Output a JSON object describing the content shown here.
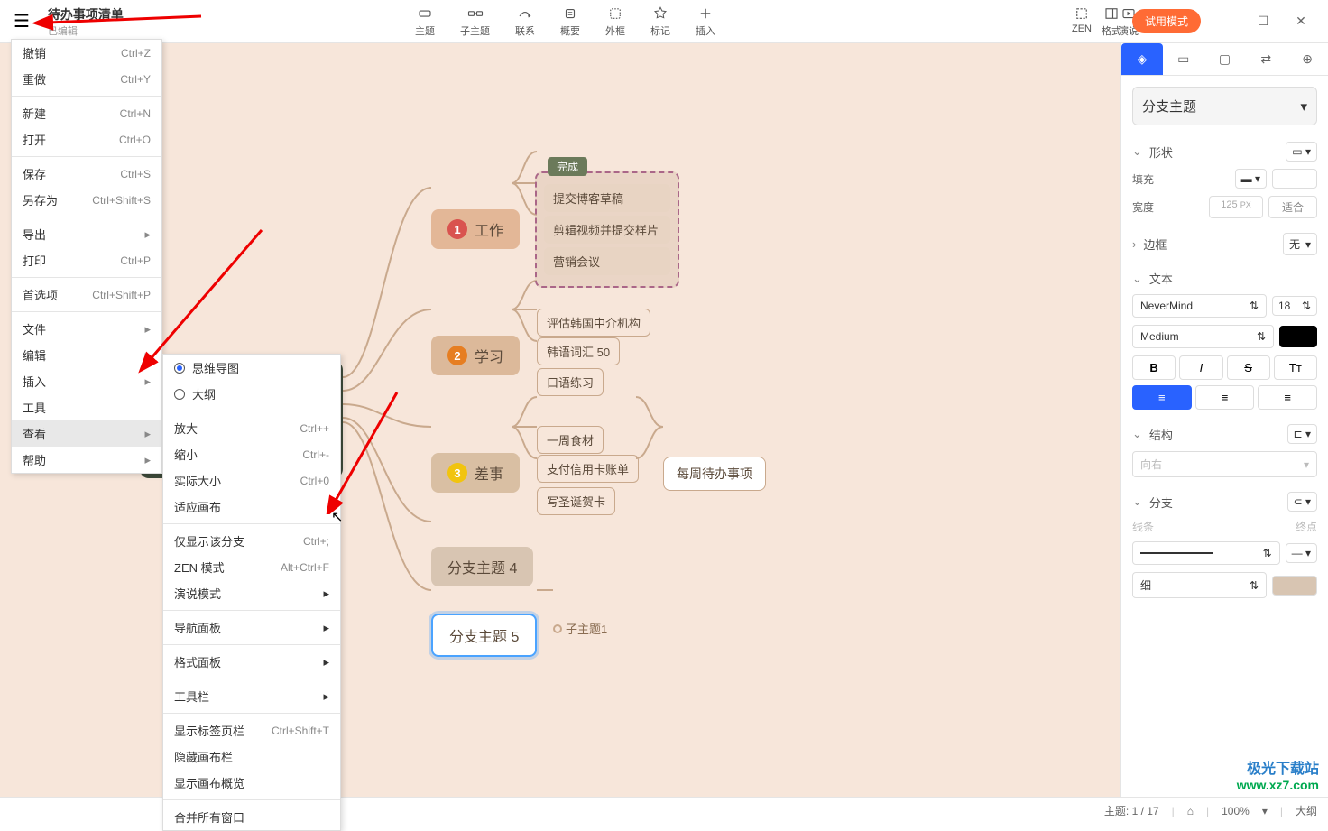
{
  "header": {
    "title": "待办事项清单",
    "subtitle": "已编辑"
  },
  "toolbar": {
    "topic": "主题",
    "subtopic": "子主题",
    "relation": "联系",
    "summary": "概要",
    "boundary": "外框",
    "marker": "标记",
    "insert": "插入",
    "zen": "ZEN",
    "present": "演说",
    "format": "格式",
    "trial": "试用模式"
  },
  "menu1": [
    {
      "label": "撤销",
      "sc": "Ctrl+Z"
    },
    {
      "label": "重做",
      "sc": "Ctrl+Y"
    },
    {
      "sep": true
    },
    {
      "label": "新建",
      "sc": "Ctrl+N"
    },
    {
      "label": "打开",
      "sc": "Ctrl+O"
    },
    {
      "sep": true
    },
    {
      "label": "保存",
      "sc": "Ctrl+S"
    },
    {
      "label": "另存为",
      "sc": "Ctrl+Shift+S"
    },
    {
      "sep": true
    },
    {
      "label": "导出",
      "arr": true
    },
    {
      "label": "打印",
      "sc": "Ctrl+P"
    },
    {
      "sep": true
    },
    {
      "label": "首选项",
      "sc": "Ctrl+Shift+P"
    },
    {
      "sep": true
    },
    {
      "label": "文件",
      "arr": true
    },
    {
      "label": "编辑",
      "arr": true
    },
    {
      "label": "插入",
      "arr": true
    },
    {
      "label": "工具"
    },
    {
      "label": "查看",
      "arr": true,
      "hl": true
    },
    {
      "label": "帮助",
      "arr": true
    }
  ],
  "menu2": [
    {
      "radio": "on",
      "label": "思维导图"
    },
    {
      "radio": "off",
      "label": "大纲"
    },
    {
      "sep": true
    },
    {
      "label": "放大",
      "sc": "Ctrl++"
    },
    {
      "label": "缩小",
      "sc": "Ctrl+-"
    },
    {
      "label": "实际大小",
      "sc": "Ctrl+0"
    },
    {
      "label": "适应画布"
    },
    {
      "sep": true
    },
    {
      "label": "仅显示该分支",
      "sc": "Ctrl+;"
    },
    {
      "label": "ZEN 模式",
      "sc": "Alt+Ctrl+F"
    },
    {
      "label": "演说模式",
      "arr": true
    },
    {
      "sep": true
    },
    {
      "label": "导航面板",
      "arr": true
    },
    {
      "sep": true
    },
    {
      "label": "格式面板",
      "arr": true
    },
    {
      "sep": true
    },
    {
      "label": "工具栏",
      "arr": true
    },
    {
      "sep": true
    },
    {
      "label": "显示标签页栏",
      "sc": "Ctrl+Shift+T"
    },
    {
      "label": "隐藏画布栏"
    },
    {
      "label": "显示画布概览"
    },
    {
      "sep": true
    },
    {
      "label": "合并所有窗口"
    }
  ],
  "mindmap": {
    "central": "每周待办事项",
    "work": {
      "title": "工作",
      "done": "完成",
      "items": [
        "提交博客草稿",
        "剪辑视频并提交样片",
        "营销会议"
      ]
    },
    "study": {
      "title": "学习",
      "items": [
        "评估韩国中介机构",
        "韩语词汇 50",
        "口语练习"
      ]
    },
    "errand": {
      "title": "差事",
      "items": [
        "一周食材",
        "支付信用卡账单",
        "写圣诞贺卡"
      ],
      "callout": "每周待办事项"
    },
    "b4": "分支主题 4",
    "b5": "分支主题 5",
    "b5child": "子主题1"
  },
  "panel": {
    "selector": "分支主题",
    "shape": {
      "title": "形状",
      "fill": "填充",
      "width": "宽度",
      "width_val": "125",
      "width_unit": "PX",
      "fit": "适合",
      "fill_color": "#d8c5b2"
    },
    "border": {
      "title": "边框",
      "value": "无"
    },
    "text": {
      "title": "文本",
      "font": "NeverMind",
      "size": "18",
      "weight": "Medium"
    },
    "structure": {
      "title": "结构",
      "dir": "向右"
    },
    "branch": {
      "title": "分支",
      "line": "线条",
      "end": "终点",
      "thick": "细",
      "color": "#d8c5b2"
    }
  },
  "status": {
    "topic": "主题: 1 / 17",
    "zoom": "100%",
    "outline": "大纲"
  },
  "watermark": {
    "t": "极光下载站",
    "u": "www.xz7.com"
  }
}
